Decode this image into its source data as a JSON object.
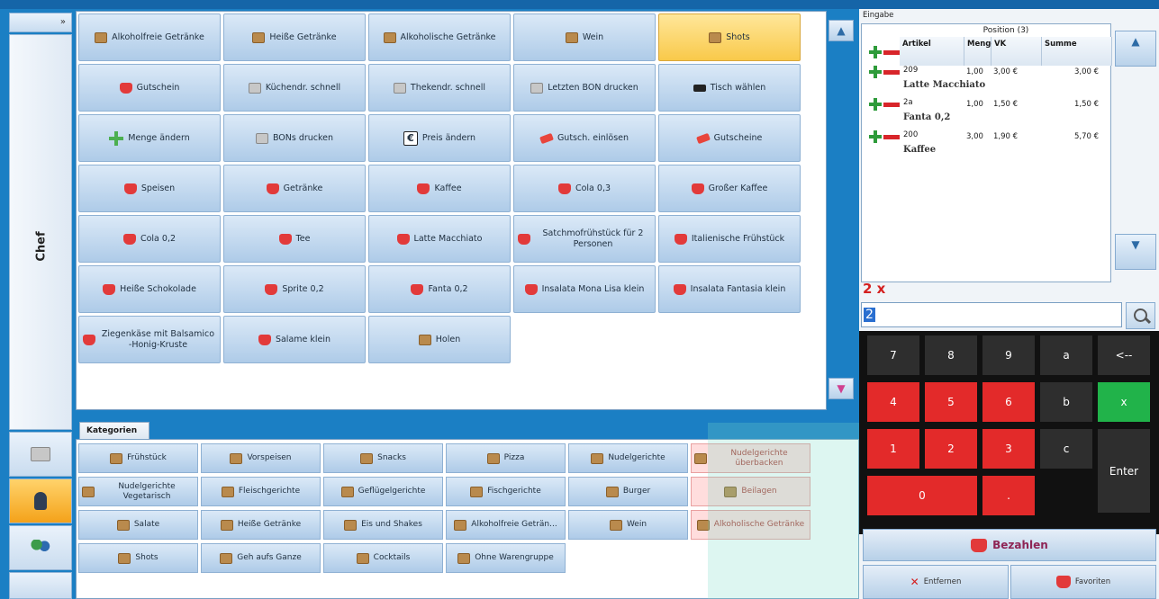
{
  "nav": {
    "collapse": "»",
    "user": "Chef"
  },
  "products": [
    {
      "label": "Alkoholfreie Getränke",
      "icon": "box-icon"
    },
    {
      "label": "Heiße Getränke",
      "icon": "box-icon"
    },
    {
      "label": "Alkoholische Getränke",
      "icon": "box-icon"
    },
    {
      "label": "Wein",
      "icon": "box-icon"
    },
    {
      "label": "Shots",
      "icon": "box-icon",
      "highlight": true
    },
    {
      "label": "Gutschein",
      "icon": "cart-icon"
    },
    {
      "label": "Küchendr. schnell",
      "icon": "printer-icon"
    },
    {
      "label": "Thekendr. schnell",
      "icon": "printer-icon"
    },
    {
      "label": "Letzten BON drucken",
      "icon": "printer-icon"
    },
    {
      "label": "Tisch wählen",
      "icon": "table-icon"
    },
    {
      "label": "Menge ändern",
      "icon": "plus-icon"
    },
    {
      "label": "BONs drucken",
      "icon": "printer-icon"
    },
    {
      "label": "Preis ändern",
      "icon": "euro-icon"
    },
    {
      "label": "Gutsch. einlösen",
      "icon": "tag-icon"
    },
    {
      "label": "Gutscheine",
      "icon": "sale-tag-icon"
    },
    {
      "label": "Speisen",
      "icon": "cart-icon"
    },
    {
      "label": "Getränke",
      "icon": "cart-icon"
    },
    {
      "label": "Kaffee",
      "icon": "cart-icon"
    },
    {
      "label": "Cola 0,3",
      "icon": "cart-icon"
    },
    {
      "label": "Großer Kaffee",
      "icon": "cart-icon"
    },
    {
      "label": "Cola 0,2",
      "icon": "cart-icon"
    },
    {
      "label": "Tee",
      "icon": "cart-icon"
    },
    {
      "label": "Latte Macchiato",
      "icon": "cart-icon"
    },
    {
      "label": "Satchmofrühstück für 2 Personen",
      "icon": "cart-icon"
    },
    {
      "label": "Italienische Frühstück",
      "icon": "cart-icon"
    },
    {
      "label": "Heiße Schokolade",
      "icon": "cart-icon"
    },
    {
      "label": "Sprite 0,2",
      "icon": "cart-icon"
    },
    {
      "label": "Fanta 0,2",
      "icon": "cart-icon"
    },
    {
      "label": "Insalata Mona Lisa klein",
      "icon": "cart-icon"
    },
    {
      "label": "Insalata Fantasia klein",
      "icon": "cart-icon"
    },
    {
      "label": "Ziegenkäse mit Balsamico -Honig-Kruste",
      "icon": "cart-icon"
    },
    {
      "label": "Salame klein",
      "icon": "cart-icon"
    },
    {
      "label": "Holen",
      "icon": "box-icon"
    }
  ],
  "categories": {
    "tab": "Kategorien",
    "items": [
      "Frühstück",
      "Vorspeisen",
      "Snacks",
      "Pizza",
      "Nudelgerichte",
      "Nudelgerichte überbacken",
      "Nudelgerichte Vegetarisch",
      "Fleischgerichte",
      "Geflügelgerichte",
      "Fischgerichte",
      "Burger",
      "Beilagen",
      "Salate",
      "Heiße Getränke",
      "Eis und Shakes",
      "Alkoholfreie Geträn...",
      "Wein",
      "Alkoholische Getränke",
      "Shots",
      "Geh aufs Ganze",
      "Cocktails",
      "Ohne Warengruppe"
    ]
  },
  "order": {
    "panel_label": "Eingabe",
    "header": "Position (3)",
    "columns": [
      "Artikel",
      "Menge",
      "VK",
      "Summe"
    ],
    "rows": [
      {
        "nr": "209",
        "name": "Latte Macchiato",
        "menge": "1,00",
        "vk": "3,00 €",
        "summe": "3,00 €"
      },
      {
        "nr": "2a",
        "name": "Fanta 0,2",
        "menge": "1,00",
        "vk": "1,50 €",
        "summe": "1,50 €"
      },
      {
        "nr": "200",
        "name": "Kaffee",
        "menge": "3,00",
        "vk": "1,90 €",
        "summe": "5,70 €"
      }
    ]
  },
  "input": {
    "qty_label": "2 x",
    "value": "2"
  },
  "keypad": {
    "keys": [
      "7",
      "8",
      "9",
      "a",
      "<--",
      "4",
      "5",
      "6",
      "b",
      "x",
      "1",
      "2",
      "3",
      "c",
      "Enter",
      "0",
      "."
    ]
  },
  "actions": {
    "pay": "Bezahlen",
    "remove": "Entfernen",
    "favorites": "Favoriten"
  },
  "colors": {
    "accent": "#1b7fc4",
    "highlight": "#f9c94a",
    "pay_text": "#8e2555",
    "keypad_red": "#e32a2a",
    "keypad_green": "#21b34a"
  }
}
